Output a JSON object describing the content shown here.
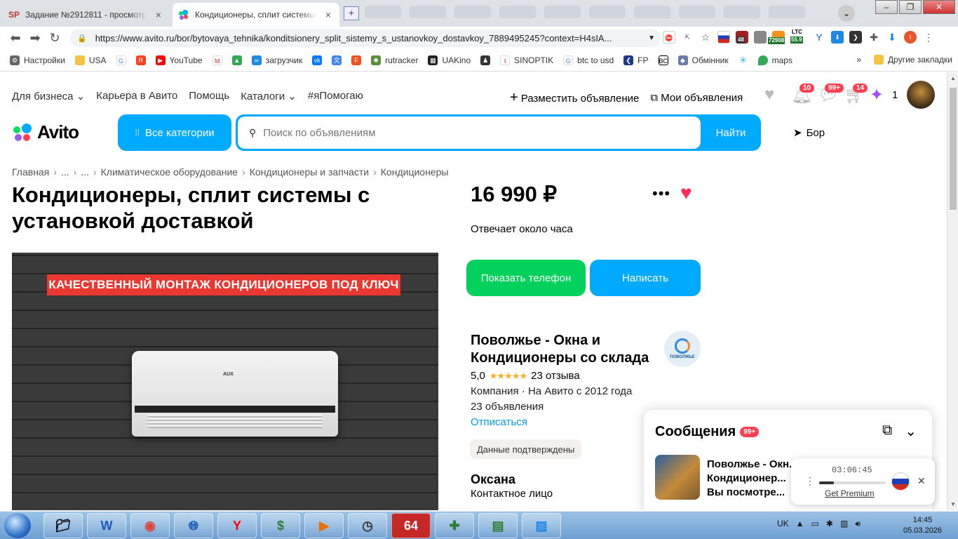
{
  "browser": {
    "tabs": [
      {
        "favicon": "SP",
        "title": "Задание №2912811 - просмотр з",
        "active": false
      },
      {
        "favicon": "avito-icon",
        "title": "Кондиционеры, сплит системы с",
        "active": true
      }
    ],
    "url": "https://www.avito.ru/bor/bytovaya_tehnika/konditsionery_split_sistemy_s_ustanovkoy_dostavkoy_7889495245?context=H4sIA...",
    "ext_labels": {
      "coin1": "72908",
      "ltc_label": "LTC",
      "ltc_value": "55.9",
      "badge": "48"
    },
    "bookmarks": [
      "Настройки",
      "USA",
      "YouTube",
      "загрузчик",
      "rutracker",
      "UAKino",
      "SINOPTIK",
      "btc to usd",
      "FP",
      "Обмінник",
      "maps"
    ],
    "bookmarks_more": "»",
    "other_bookmarks": "Другие закладки"
  },
  "avito": {
    "topnav": [
      "Для бизнеса",
      "Карьера в Авито",
      "Помощь",
      "Каталоги",
      "#яПомогаю"
    ],
    "post_ad": "Разместить объявление",
    "my_ads": "Мои объявления",
    "badges": {
      "notifications": "10",
      "messages": "99+",
      "cart": "14",
      "bonus": "1"
    },
    "logo_text": "Avito",
    "categories_btn": "Все категории",
    "search_placeholder": "Поиск по объявлениям",
    "search_btn": "Найти",
    "city": "Бор",
    "breadcrumbs": [
      "Главная",
      "...",
      "...",
      "Климатическое оборудование",
      "Кондиционеры и запчасти",
      "Кондиционеры"
    ],
    "title": "Кондиционеры, сплит системы с установкой доставкой",
    "photo_banner": "КАЧЕСТВЕННЫЙ МОНТАЖ КОНДИЦИОНЕРОВ ПОД КЛЮЧ",
    "photo_brand": "AUX",
    "price": "16 990 ₽",
    "reply_time": "Отвечает около часа",
    "show_phone": "Показать телефон",
    "write": "Написать",
    "seller_name": "Поволжье - Окна и Кондиционеры со склада",
    "seller_logo_text": "ПОВОЛЖЬЕ",
    "rating": "5,0",
    "stars": "★★★★★",
    "reviews": "23 отзыва",
    "company_info": "Компания · На Авито с 2012 года",
    "ads_count": "23 объявления",
    "unsubscribe": "Отписаться",
    "verified": "Данные подтверждены",
    "contact_name": "Оксана",
    "contact_role": "Контактное лицо"
  },
  "messages_widget": {
    "title": "Сообщения",
    "badge": "99+",
    "preview": "Поволжье - Окн... Кондиционер... Вы посмотре..."
  },
  "player": {
    "time": "03:06:45",
    "progress": 0.22,
    "premium": "Get Premium"
  },
  "taskbar": {
    "lang": "UK",
    "time": "14:45",
    "date": "05.03.2026"
  }
}
